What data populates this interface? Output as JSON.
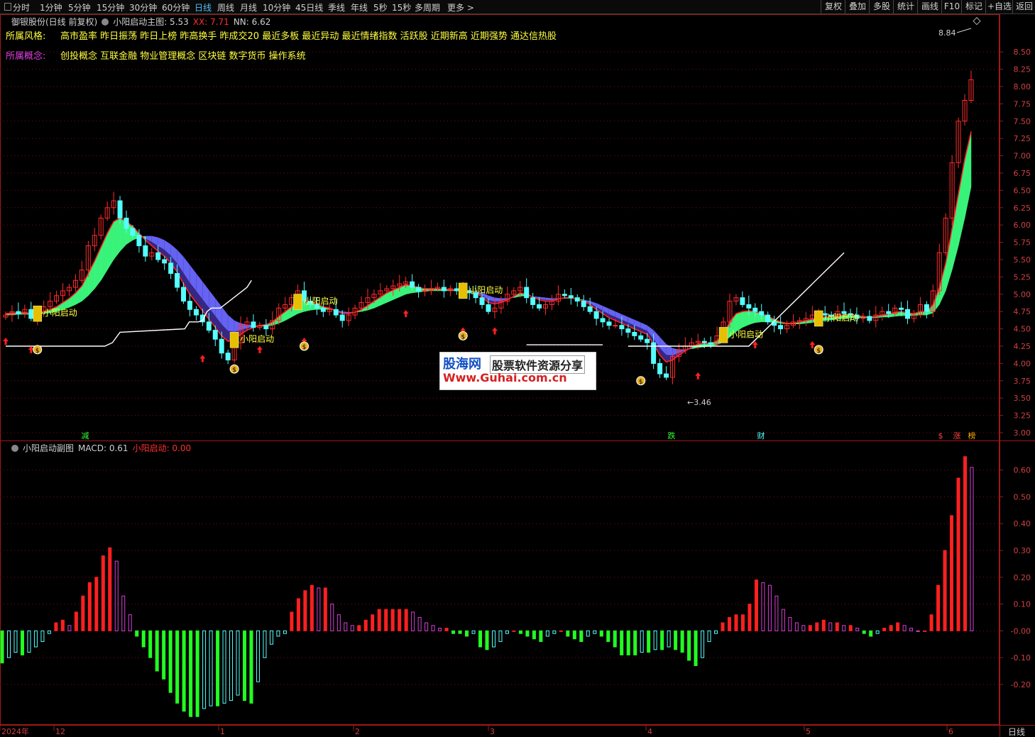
{
  "toolbar": {
    "periods": [
      "分时",
      "1分钟",
      "5分钟",
      "15分钟",
      "30分钟",
      "60分钟",
      "日线",
      "周线",
      "月线",
      "10分钟",
      "45日线",
      "季线",
      "年线",
      "5秒",
      "15秒",
      "多周期",
      "更多 >"
    ],
    "active_period": "日线",
    "tools": [
      "复权",
      "叠加",
      "多股",
      "统计",
      "画线",
      "F10",
      "标记",
      "+自选",
      "返回"
    ]
  },
  "main_header": {
    "stock": "御银股份(日线 前复权)",
    "indicator": "小阳启动主图",
    "value_label": ": 5.53",
    "xx": "XX: 7.71",
    "nn": "NN: 6.62"
  },
  "style_label": "所属风格:",
  "style_text": "高市盈率 昨日振荡 昨日上榜 昨高换手 昨成交20 最近多板 最近异动 最近情绪指数 活跃股 近期新高 近期强势 通达信热股",
  "concept_label": "所属概念:",
  "concept_text": "创投概念 互联金融 物业管理概念 区块链 数字货币 操作系统",
  "sub_header": {
    "indicator": "小阳启动副图",
    "macd": "MACD: 0.61",
    "signal": "小阳启动: 0.00"
  },
  "annotations": {
    "high": "8.84",
    "low": "3.46",
    "signal_text": "小阳启动",
    "markers": [
      "减",
      "跌",
      "财",
      "$",
      "涨",
      "榜"
    ]
  },
  "watermark": {
    "brand": "股海网",
    "slogan": "股票软件资源分享",
    "url": "Www.Guhai.com.cn"
  },
  "x_axis_labels": [
    "2024年",
    "12",
    "1",
    "2",
    "3",
    "4",
    "5",
    "6"
  ],
  "period_tag": "日线",
  "colors": {
    "up": "#ff2b2b",
    "down": "#54ffff",
    "macd_pos_rising": "#ff2020",
    "macd_pos_falling": "#d640d6",
    "macd_neg_falling": "#22ff22",
    "macd_neg_rising": "#54ffff",
    "ribbon_up": "#3dff80",
    "ribbon_down": "#3a2a8a",
    "ribbon_mid": "#6a6aff",
    "grid": "#7a1010",
    "label_yellow": "#ffff40"
  },
  "chart_data": [
    {
      "type": "candlestick",
      "title": "小阳启动主图",
      "ylim": [
        3.0,
        8.84
      ],
      "y_ticks": [
        3.0,
        3.25,
        3.5,
        3.75,
        4.0,
        4.25,
        4.5,
        4.75,
        5.0,
        5.25,
        5.5,
        5.75,
        6.0,
        6.25,
        6.5,
        6.75,
        7.0,
        7.25,
        7.5,
        7.75,
        8.0,
        8.25,
        8.5
      ],
      "y_tick_labels": [
        "3.00",
        "3.25",
        "3.50",
        "3.75",
        "4.00",
        "4.25",
        "4.50",
        "4.75",
        "5.00",
        "5.25",
        "5.50",
        "5.75",
        "6.00",
        "6.25",
        "6.50",
        "6.75",
        "7.00",
        "7.25",
        "7.50",
        "7.75",
        "8.00",
        "8.25",
        "8.50"
      ],
      "close": [
        4.7,
        4.75,
        4.72,
        4.78,
        4.65,
        4.75,
        4.82,
        4.9,
        4.98,
        5.05,
        5.1,
        5.2,
        5.35,
        5.7,
        5.85,
        6.1,
        6.25,
        6.35,
        6.1,
        5.95,
        5.85,
        5.7,
        5.55,
        5.6,
        5.5,
        5.45,
        5.3,
        5.1,
        4.9,
        4.78,
        4.7,
        4.6,
        4.48,
        4.35,
        4.15,
        4.05,
        4.3,
        4.55,
        4.6,
        4.52,
        4.55,
        4.5,
        4.62,
        4.8,
        4.85,
        4.95,
        5.05,
        4.9,
        4.85,
        4.8,
        4.75,
        4.78,
        4.7,
        4.62,
        4.7,
        4.8,
        4.88,
        4.95,
        5.0,
        5.05,
        5.08,
        5.12,
        5.15,
        5.18,
        5.1,
        5.05,
        5.05,
        5.08,
        5.1,
        5.05,
        5.08,
        5.05,
        5.05,
        5.02,
        4.95,
        4.85,
        4.75,
        4.8,
        4.9,
        5.0,
        5.05,
        5.1,
        4.95,
        4.85,
        4.8,
        4.85,
        4.9,
        5.0,
        4.98,
        4.95,
        4.9,
        4.82,
        4.75,
        4.65,
        4.6,
        4.55,
        4.55,
        4.5,
        4.45,
        4.4,
        4.35,
        4.3,
        4.0,
        3.85,
        3.8,
        4.1,
        4.2,
        4.25,
        4.3,
        4.32,
        4.3,
        4.28,
        4.4,
        4.6,
        4.9,
        4.95,
        4.85,
        4.8,
        4.75,
        4.7,
        4.6,
        4.55,
        4.5,
        4.55,
        4.6,
        4.62,
        4.65,
        4.7,
        4.72,
        4.7,
        4.68,
        4.75,
        4.72,
        4.7,
        4.65,
        4.68,
        4.62,
        4.7,
        4.75,
        4.72,
        4.8,
        4.78,
        4.65,
        4.7,
        4.85,
        4.75,
        5.05,
        5.6,
        6.1,
        6.9,
        7.5,
        7.8,
        8.1
      ],
      "ma_fast": [
        4.72,
        4.73,
        4.73,
        4.74,
        4.72,
        4.73,
        4.75,
        4.78,
        4.82,
        4.88,
        4.94,
        5.02,
        5.12,
        5.3,
        5.48,
        5.68,
        5.88,
        6.05,
        6.1,
        6.05,
        5.98,
        5.88,
        5.78,
        5.7,
        5.62,
        5.55,
        5.45,
        5.32,
        5.15,
        5.0,
        4.88,
        4.76,
        4.64,
        4.52,
        4.4,
        4.32,
        4.35,
        4.42,
        4.48,
        4.52,
        4.55,
        4.56,
        4.6,
        4.68,
        4.75,
        4.82,
        4.9,
        4.9,
        4.88,
        4.86,
        4.82,
        4.8,
        4.76,
        4.72,
        4.72,
        4.74,
        4.78,
        4.84,
        4.9,
        4.96,
        5.02,
        5.06,
        5.1,
        5.14,
        5.12,
        5.1,
        5.08,
        5.08,
        5.08,
        5.07,
        5.07,
        5.06,
        5.06,
        5.05,
        5.02,
        4.96,
        4.88,
        4.86,
        4.88,
        4.92,
        4.97,
        5.02,
        5.0,
        4.96,
        4.92,
        4.9,
        4.9,
        4.93,
        4.95,
        4.95,
        4.93,
        4.9,
        4.85,
        4.78,
        4.72,
        4.66,
        4.62,
        4.58,
        4.54,
        4.5,
        4.46,
        4.42,
        4.28,
        4.12,
        4.02,
        4.05,
        4.12,
        4.18,
        4.24,
        4.28,
        4.29,
        4.29,
        4.33,
        4.42,
        4.6,
        4.72,
        4.75,
        4.76,
        4.75,
        4.72,
        4.68,
        4.64,
        4.6,
        4.58,
        4.58,
        4.6,
        4.62,
        4.64,
        4.66,
        4.67,
        4.67,
        4.69,
        4.7,
        4.7,
        4.69,
        4.68,
        4.67,
        4.68,
        4.7,
        4.71,
        4.74,
        4.75,
        4.73,
        4.72,
        4.75,
        4.75,
        4.85,
        5.1,
        5.45,
        5.95,
        6.45,
        6.95,
        7.35
      ],
      "ma_slow": [
        4.7,
        4.7,
        4.71,
        4.71,
        4.71,
        4.71,
        4.72,
        4.73,
        4.75,
        4.78,
        4.81,
        4.85,
        4.9,
        4.98,
        5.08,
        5.2,
        5.35,
        5.5,
        5.62,
        5.72,
        5.78,
        5.82,
        5.84,
        5.84,
        5.82,
        5.78,
        5.72,
        5.64,
        5.54,
        5.42,
        5.3,
        5.18,
        5.06,
        4.94,
        4.82,
        4.7,
        4.62,
        4.58,
        4.56,
        4.55,
        4.54,
        4.54,
        4.55,
        4.58,
        4.62,
        4.67,
        4.72,
        4.75,
        4.77,
        4.78,
        4.78,
        4.78,
        4.77,
        4.75,
        4.74,
        4.74,
        4.75,
        4.77,
        4.8,
        4.84,
        4.88,
        4.92,
        4.96,
        5.0,
        5.02,
        5.03,
        5.04,
        5.05,
        5.05,
        5.05,
        5.05,
        5.05,
        5.05,
        5.05,
        5.04,
        5.02,
        4.98,
        4.95,
        4.94,
        4.94,
        4.95,
        4.97,
        4.98,
        4.97,
        4.96,
        4.95,
        4.94,
        4.94,
        4.94,
        4.94,
        4.93,
        4.92,
        4.9,
        4.87,
        4.83,
        4.79,
        4.75,
        4.71,
        4.67,
        4.63,
        4.59,
        4.55,
        4.48,
        4.38,
        4.28,
        4.22,
        4.2,
        4.2,
        4.21,
        4.23,
        4.24,
        4.25,
        4.27,
        4.31,
        4.38,
        4.46,
        4.52,
        4.56,
        4.59,
        4.6,
        4.6,
        4.59,
        4.58,
        4.57,
        4.57,
        4.57,
        4.58,
        4.59,
        4.61,
        4.62,
        4.63,
        4.64,
        4.65,
        4.66,
        4.66,
        4.66,
        4.66,
        4.66,
        4.67,
        4.67,
        4.68,
        4.69,
        4.69,
        4.69,
        4.7,
        4.7,
        4.73,
        4.85,
        5.05,
        5.35,
        5.7,
        6.1,
        6.55
      ],
      "white_line": [
        4.25,
        4.25,
        4.25,
        4.25,
        4.25,
        4.25,
        4.25,
        4.25,
        4.25,
        4.25,
        4.25,
        4.25,
        4.25,
        4.25,
        4.3,
        4.45,
        4.5,
        4.6,
        4.6,
        4.6,
        4.62,
        4.75,
        4.8,
        4.8,
        4.8,
        4.85,
        4.9,
        4.95,
        5.0,
        5.05,
        5.1,
        5.2
      ],
      "signals": [
        "小阳启动 x11"
      ]
    },
    {
      "type": "bar",
      "title": "小阳启动副图",
      "ylim": [
        -0.33,
        0.66
      ],
      "y_ticks": [
        -0.2,
        -0.1,
        0.0,
        0.1,
        0.2,
        0.3,
        0.4,
        0.5,
        0.6
      ],
      "y_tick_labels": [
        "-0.20",
        "-0.10",
        "-0.00",
        "0.10",
        "0.20",
        "0.30",
        "0.40",
        "0.50",
        "0.60"
      ],
      "values": [
        -0.12,
        -0.1,
        -0.08,
        -0.09,
        -0.08,
        -0.06,
        -0.04,
        -0.01,
        0.03,
        0.04,
        0.02,
        0.07,
        0.13,
        0.18,
        0.2,
        0.28,
        0.31,
        0.26,
        0.13,
        0.06,
        -0.02,
        -0.06,
        -0.1,
        -0.15,
        -0.18,
        -0.23,
        -0.27,
        -0.3,
        -0.32,
        -0.32,
        -0.29,
        -0.28,
        -0.28,
        -0.27,
        -0.26,
        -0.24,
        -0.26,
        -0.27,
        -0.19,
        -0.1,
        -0.05,
        -0.02,
        -0.01,
        0.07,
        0.12,
        0.15,
        0.17,
        0.16,
        0.16,
        0.1,
        0.06,
        0.03,
        0.02,
        0.02,
        0.04,
        0.06,
        0.08,
        0.08,
        0.08,
        0.08,
        0.08,
        0.07,
        0.05,
        0.03,
        0.02,
        0.01,
        0.01,
        -0.01,
        -0.01,
        -0.02,
        -0.01,
        -0.06,
        -0.07,
        -0.06,
        -0.04,
        -0.01,
        0.0,
        -0.01,
        -0.02,
        -0.03,
        -0.04,
        -0.02,
        -0.01,
        0.0,
        -0.02,
        -0.03,
        -0.04,
        -0.02,
        -0.01,
        -0.02,
        -0.04,
        -0.06,
        -0.09,
        -0.09,
        -0.09,
        -0.08,
        -0.08,
        -0.07,
        -0.07,
        -0.06,
        -0.07,
        -0.08,
        -0.11,
        -0.13,
        -0.1,
        -0.04,
        -0.01,
        0.03,
        0.05,
        0.06,
        0.06,
        0.1,
        0.19,
        0.18,
        0.17,
        0.13,
        0.08,
        0.05,
        0.03,
        0.02,
        0.02,
        0.03,
        0.04,
        0.03,
        0.03,
        0.02,
        0.02,
        0.01,
        -0.01,
        -0.02,
        -0.01,
        0.01,
        0.02,
        0.03,
        0.02,
        0.01,
        0.0,
        0.0,
        0.06,
        0.17,
        0.3,
        0.43,
        0.57,
        0.65,
        0.61
      ]
    }
  ]
}
